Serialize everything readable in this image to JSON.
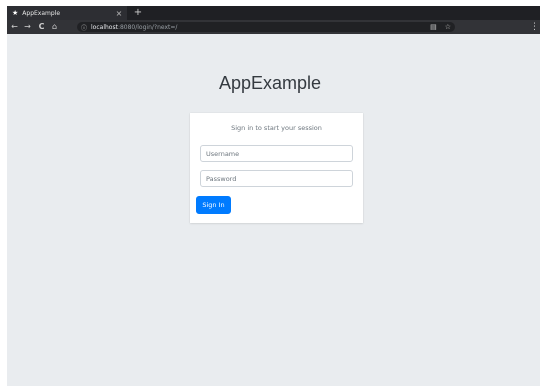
{
  "browser": {
    "tab_title": "AppExample",
    "tab_close": "×",
    "new_tab": "+",
    "url_host": "localhost",
    "url_rest": ":8080/login/?next=/",
    "icons": [
      "back-icon",
      "forward-icon",
      "reload-icon",
      "home-icon",
      "info-icon",
      "translate-icon",
      "star-icon",
      "menu-icon"
    ]
  },
  "page": {
    "title": "AppExample",
    "login_message": "Sign in to start your session",
    "username_placeholder": "Username",
    "password_placeholder": "Password",
    "signin_label": "Sign In"
  },
  "colors": {
    "page_bg": "#e9ecef",
    "card_bg": "#ffffff",
    "primary": "#007bff"
  }
}
